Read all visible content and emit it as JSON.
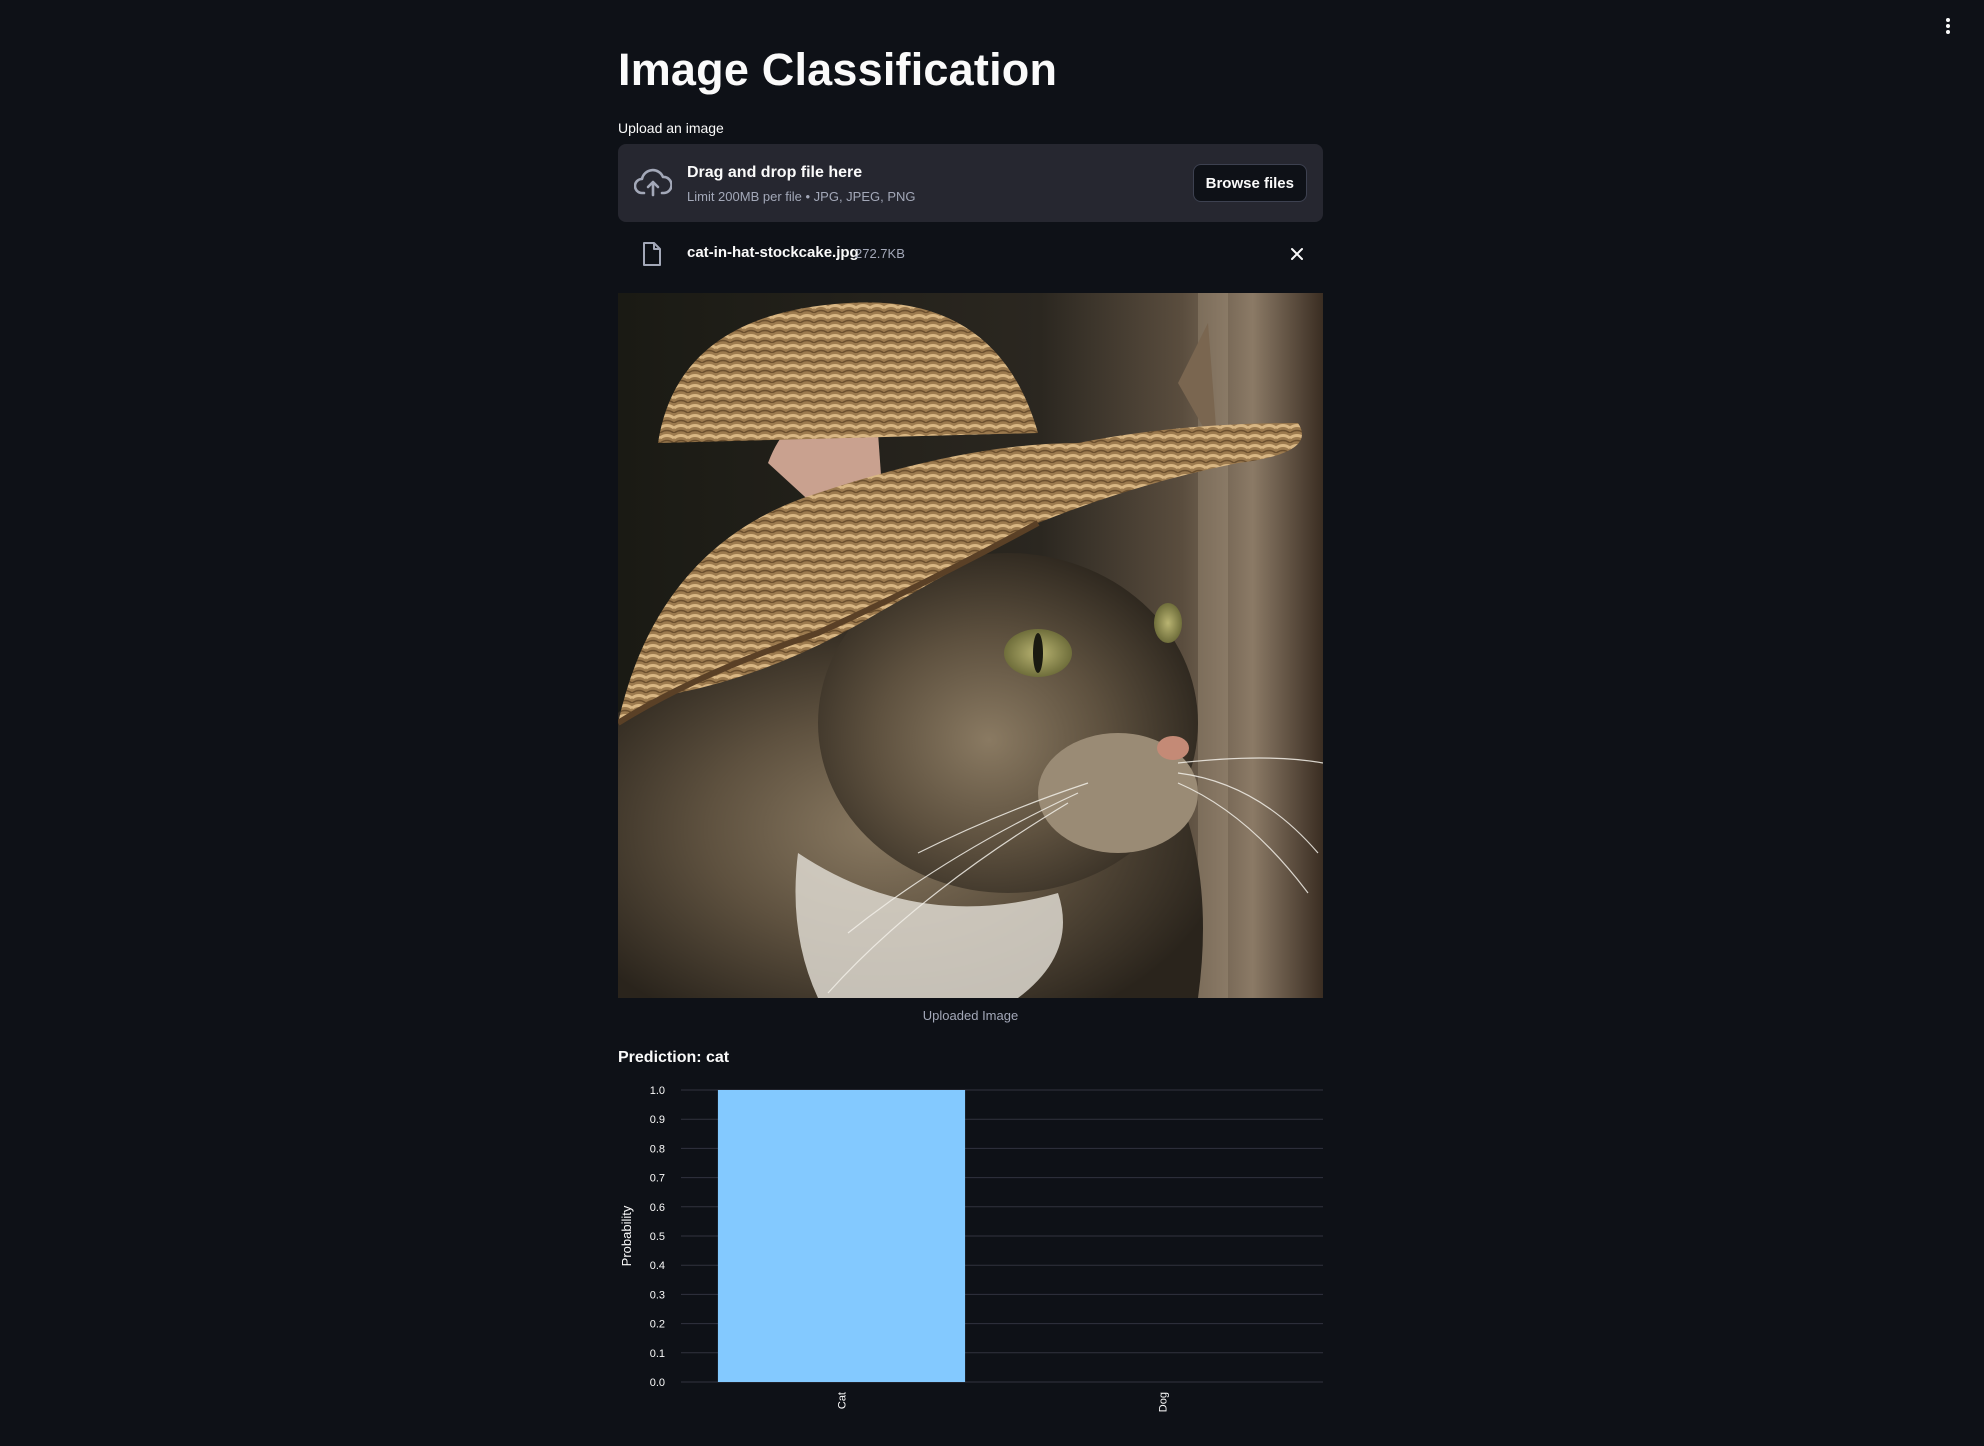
{
  "app": {
    "title": "Image Classification"
  },
  "uploader": {
    "label": "Upload an image",
    "drop_title": "Drag and drop file here",
    "drop_subtitle": "Limit 200MB per file • JPG, JPEG, PNG",
    "browse_label": "Browse files",
    "file_name": "cat-in-hat-stockcake.jpg",
    "file_size": "272.7KB"
  },
  "image": {
    "caption": "Uploaded Image"
  },
  "result": {
    "prediction_text": "Prediction: cat"
  },
  "chart_data": {
    "type": "bar",
    "categories": [
      "Cat",
      "Dog"
    ],
    "values": [
      1.0,
      0.0
    ],
    "title": "",
    "xlabel": "",
    "ylabel": "Probability",
    "ylim": [
      0,
      1.0
    ],
    "yticks": [
      "0.0",
      "0.1",
      "0.2",
      "0.3",
      "0.4",
      "0.5",
      "0.6",
      "0.7",
      "0.8",
      "0.9",
      "1.0"
    ],
    "grid": true,
    "bar_color": "#83c9ff"
  },
  "theme": {
    "background": "#0e1117",
    "surface": "#262730",
    "accent": "#83c9ff",
    "text": "#fafafa",
    "muted_text": "#a3a8b8"
  }
}
